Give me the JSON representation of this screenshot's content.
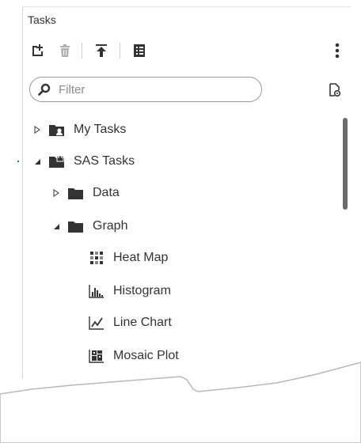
{
  "panel": {
    "title": "Tasks"
  },
  "toolbar": {
    "buttons": [
      {
        "name": "new-task-button",
        "icon": "new-task-icon"
      },
      {
        "name": "delete-button",
        "icon": "trash-icon"
      },
      {
        "name": "upload-button",
        "icon": "upload-icon"
      },
      {
        "name": "properties-button",
        "icon": "properties-icon"
      },
      {
        "name": "more-options-button",
        "icon": "vertical-ellipsis-icon"
      }
    ]
  },
  "search": {
    "placeholder": "Filter",
    "value": ""
  },
  "tree": {
    "my_tasks": "My Tasks",
    "sas_tasks": "SAS Tasks",
    "data": "Data",
    "graph": "Graph",
    "heat_map": "Heat Map",
    "histogram": "Histogram",
    "line_chart": "Line Chart",
    "mosaic_plot": "Mosaic Plot"
  },
  "colors": {
    "icon": "#333333",
    "disabled_icon": "#b0b0b0",
    "accent": "#2a6db0"
  }
}
